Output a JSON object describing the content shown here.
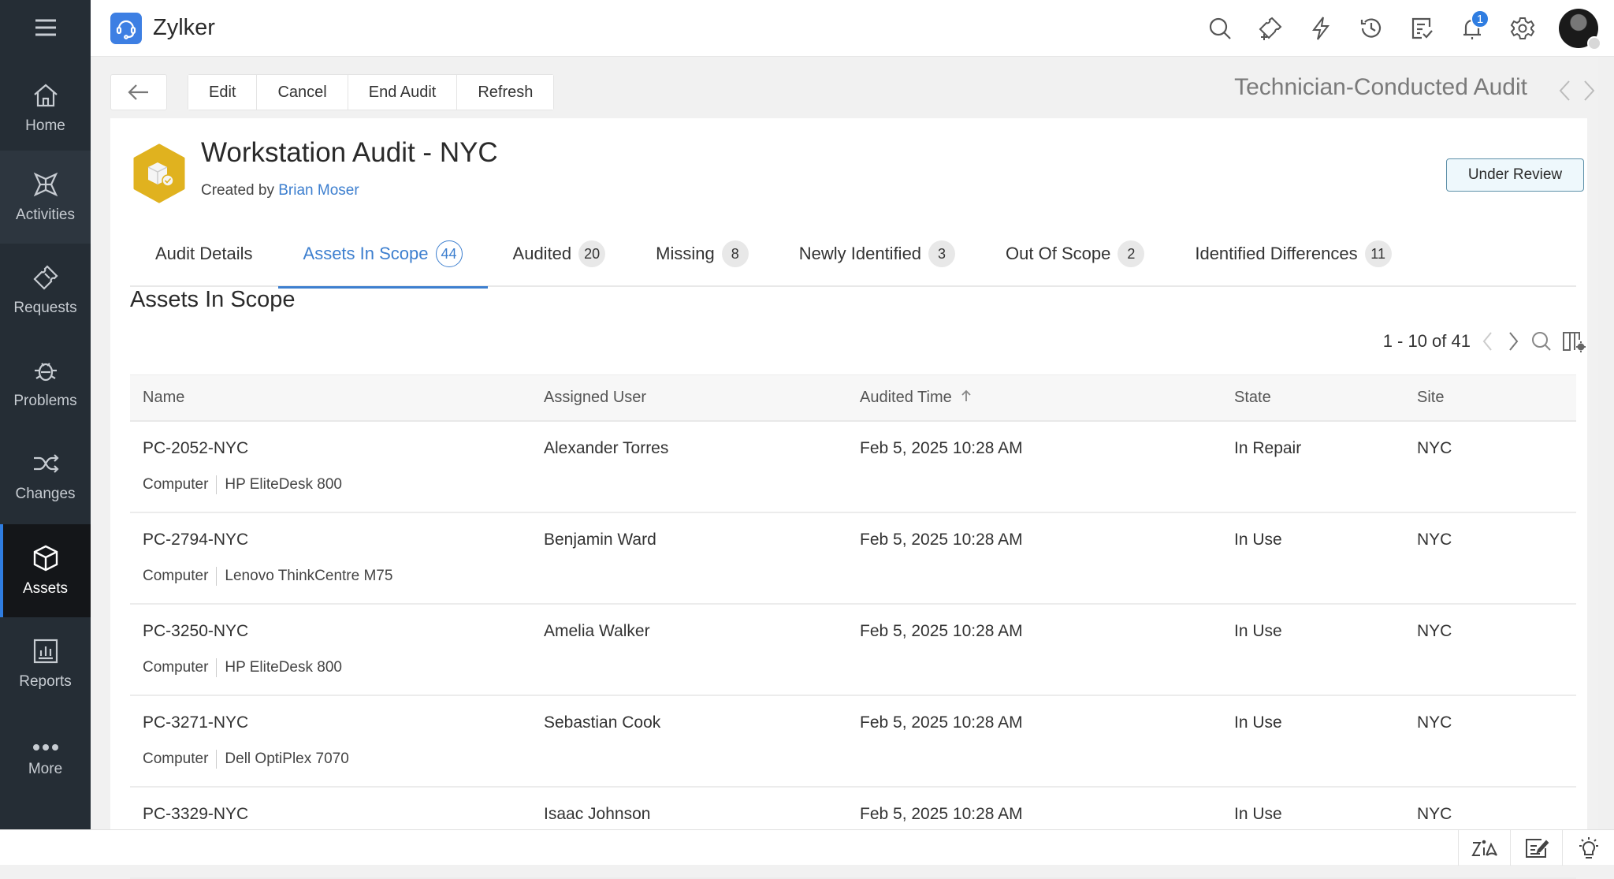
{
  "app": {
    "title": "Zylker",
    "notification_count": "1"
  },
  "sidebar": {
    "items": [
      {
        "label": "Home",
        "icon": "home-icon"
      },
      {
        "label": "Activities",
        "icon": "activities-icon"
      },
      {
        "label": "Requests",
        "icon": "ticket-icon"
      },
      {
        "label": "Problems",
        "icon": "bug-icon"
      },
      {
        "label": "Changes",
        "icon": "shuffle-icon"
      },
      {
        "label": "Assets",
        "icon": "cube-icon"
      },
      {
        "label": "Reports",
        "icon": "bar-chart-icon"
      },
      {
        "label": "More",
        "icon": "more-dots-icon"
      }
    ],
    "active": "Assets"
  },
  "toolbar": {
    "edit_label": "Edit",
    "cancel_label": "Cancel",
    "end_audit_label": "End Audit",
    "refresh_label": "Refresh",
    "audit_type": "Technician-Conducted Audit"
  },
  "audit": {
    "title": "Workstation Audit - NYC",
    "created_by_prefix": "Created by",
    "created_by_name": "Brian Moser",
    "status": "Under Review"
  },
  "tabs": [
    {
      "label": "Audit Details",
      "count": null
    },
    {
      "label": "Assets In Scope",
      "count": "44"
    },
    {
      "label": "Audited",
      "count": "20"
    },
    {
      "label": "Missing",
      "count": "8"
    },
    {
      "label": "Newly Identified",
      "count": "3"
    },
    {
      "label": "Out Of Scope",
      "count": "2"
    },
    {
      "label": "Identified Differences",
      "count": "11"
    }
  ],
  "active_tab": "Assets In Scope",
  "section": {
    "title": "Assets In Scope",
    "pagination": "1 - 10 of 41"
  },
  "table": {
    "columns": [
      "Name",
      "Assigned User",
      "Audited Time",
      "State",
      "Site"
    ],
    "sort_column": "Audited Time",
    "sort_direction": "ascending",
    "rows": [
      {
        "name": "PC-2052-NYC",
        "type": "Computer",
        "model": "HP EliteDesk 800",
        "user": "Alexander Torres",
        "time": "Feb 5, 2025 10:28 AM",
        "state": "In Repair",
        "site": "NYC"
      },
      {
        "name": "PC-2794-NYC",
        "type": "Computer",
        "model": "Lenovo ThinkCentre M75",
        "user": "Benjamin Ward",
        "time": "Feb 5, 2025 10:28 AM",
        "state": "In Use",
        "site": "NYC"
      },
      {
        "name": "PC-3250-NYC",
        "type": "Computer",
        "model": "HP EliteDesk 800",
        "user": "Amelia Walker",
        "time": "Feb 5, 2025 10:28 AM",
        "state": "In Use",
        "site": "NYC"
      },
      {
        "name": "PC-3271-NYC",
        "type": "Computer",
        "model": "Dell OptiPlex 7070",
        "user": "Sebastian Cook",
        "time": "Feb 5, 2025 10:28 AM",
        "state": "In Use",
        "site": "NYC"
      },
      {
        "name": "PC-3329-NYC",
        "type": "",
        "model": "",
        "user": "Isaac Johnson",
        "time": "Feb 5, 2025 10:28 AM",
        "state": "In Use",
        "site": "NYC"
      }
    ]
  },
  "colors": {
    "accent": "#3d7fcf",
    "sidebar_bg": "#252d35",
    "sidebar_active_bg": "#141619",
    "audit_icon": "#e0b21f",
    "status_bg": "#eef8fc"
  }
}
